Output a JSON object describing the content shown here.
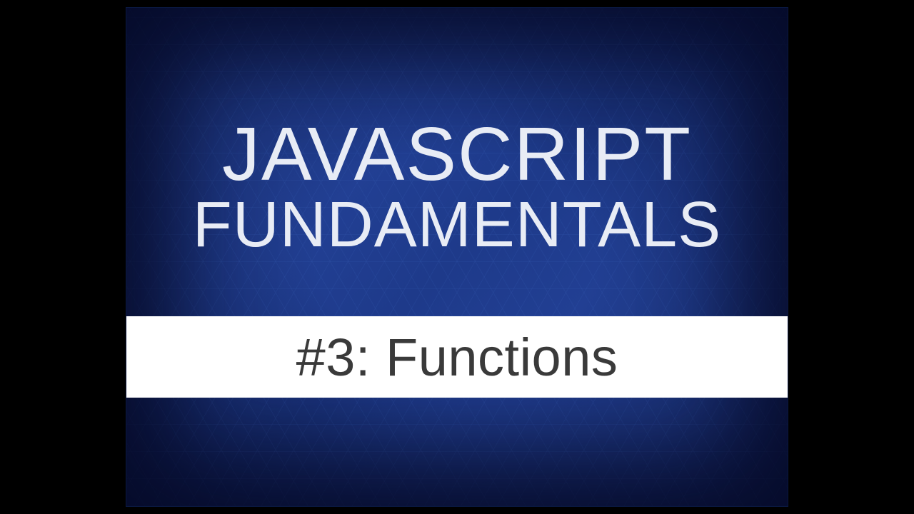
{
  "slide": {
    "title_line1": "JAVASCRIPT",
    "title_line2": "FUNDAMENTALS",
    "subtitle": "#3: Functions"
  },
  "colors": {
    "background": "#000000",
    "slide_blue": "#2a4ba8",
    "title_text": "#e8ecf5",
    "subtitle_bg": "#ffffff",
    "subtitle_text": "#3a3a3a"
  }
}
